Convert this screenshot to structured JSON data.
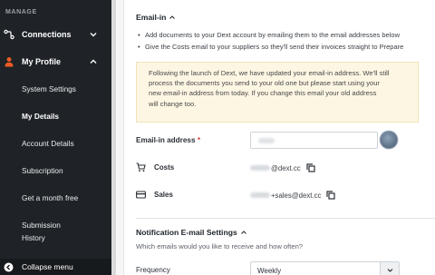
{
  "sidebar": {
    "section_label": "MANAGE",
    "items": [
      {
        "label": "Connections",
        "icon": "connections-icon",
        "expanded": false
      },
      {
        "label": "My Profile",
        "icon": "profile-icon",
        "expanded": true
      }
    ],
    "sub_items": [
      {
        "label": "System Settings",
        "active": false
      },
      {
        "label": "My Details",
        "active": true
      },
      {
        "label": "Account Details",
        "active": false
      },
      {
        "label": "Subscription",
        "active": false
      },
      {
        "label": "Get a month free",
        "active": false
      },
      {
        "label": "Submission",
        "active": false
      },
      {
        "label": "History",
        "active": false
      }
    ],
    "collapse_label": "Collapse menu",
    "accent_color": "#f15a24"
  },
  "email_in": {
    "title": "Email-in",
    "bullets": [
      "Add documents to your Dext account by emailing them to the email addresses below",
      "Give the Costs email to your suppliers so they'll send their invoices straight to Prepare"
    ],
    "notice": "Following the launch of Dext, we have updated your email-in address. We'll still\nprocess the documents you send to your old one but please start using your\nnew email-in address from today. If you change this email your old address\nwill change too.",
    "address_label": "Email-in address",
    "required_mark": "*",
    "costs_label": "Costs",
    "costs_domain": "@dext.cc",
    "sales_label": "Sales",
    "sales_domain": "+sales@dext.cc"
  },
  "notifications": {
    "title": "Notification E-mail Settings",
    "subtitle": "Which emails would you like to receive and how often?",
    "frequency_label": "Frequency",
    "frequency_value": "Weekly"
  }
}
